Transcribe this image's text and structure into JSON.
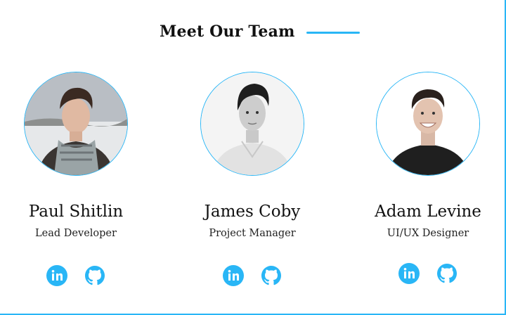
{
  "section": {
    "title": "Meet Our Team"
  },
  "members": [
    {
      "name": "Paul Shitlin",
      "role": "Lead Developer"
    },
    {
      "name": "James Coby",
      "role": "Project Manager"
    },
    {
      "name": "Adam Levine",
      "role": "UI/UX Designer"
    }
  ],
  "icons": {
    "linkedin": "linkedin-icon",
    "github": "github-icon"
  },
  "colors": {
    "accent": "#29b6f6",
    "text": "#111111"
  }
}
